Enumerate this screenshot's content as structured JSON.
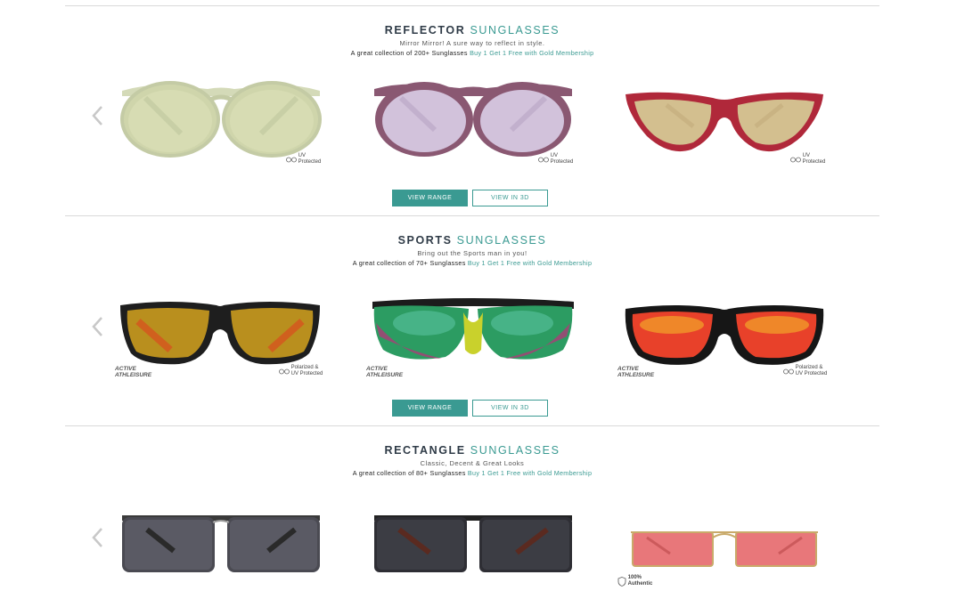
{
  "colors": {
    "accent": "#3a9a92",
    "heading": "#2f3b47",
    "divider": "#d9d9d9"
  },
  "sections": [
    {
      "title_bold": "REFLECTOR",
      "title_accent": "SUNGLASSES",
      "subtitle": "Mirror Mirror! A sure way to reflect in style.",
      "collection": "A great collection of 200+ Sunglasses",
      "offer": "Buy 1 Get 1 Free with Gold Membership",
      "view_range": "VIEW RANGE",
      "view_3d": "VIEW IN 3D",
      "products": [
        {
          "name": "sage-round-reflector",
          "badge_line1": "UV",
          "badge_line2": "Protected"
        },
        {
          "name": "purple-round-reflector",
          "badge_line1": "UV",
          "badge_line2": "Protected"
        },
        {
          "name": "red-cateye-reflector",
          "badge_line1": "UV",
          "badge_line2": "Protected"
        }
      ]
    },
    {
      "title_bold": "SPORTS",
      "title_accent": "SUNGLASSES",
      "subtitle": "Bring out the Sports man in you!",
      "collection": "A great collection of 70+ Sunglasses",
      "offer": "Buy 1 Get 1 Free with Gold Membership",
      "view_range": "VIEW RANGE",
      "view_3d": "VIEW IN 3D",
      "products": [
        {
          "name": "black-amber-sports",
          "brand1": "ACTIVE",
          "brand2": "ATHLEISURE",
          "badge_line1": "Polarized &",
          "badge_line2": "UV Protected"
        },
        {
          "name": "green-mirror-shield-sports",
          "brand1": "ACTIVE",
          "brand2": "ATHLEISURE"
        },
        {
          "name": "red-mirror-wrap-sports",
          "brand1": "ACTIVE",
          "brand2": "ATHLEISURE",
          "badge_line1": "Polarized &",
          "badge_line2": "UV Protected"
        }
      ]
    },
    {
      "title_bold": "RECTANGLE",
      "title_accent": "SUNGLASSES",
      "subtitle": "Classic, Decent & Great Looks",
      "collection": "A great collection of 80+ Sunglasses",
      "offer": "Buy 1 Get 1 Free with Gold Membership",
      "products": [
        {
          "name": "gunmetal-rectangle"
        },
        {
          "name": "black-rectangle"
        },
        {
          "name": "gold-pink-rectangle",
          "badge_line1": "100%",
          "badge_line2": "Authentic"
        }
      ]
    }
  ]
}
